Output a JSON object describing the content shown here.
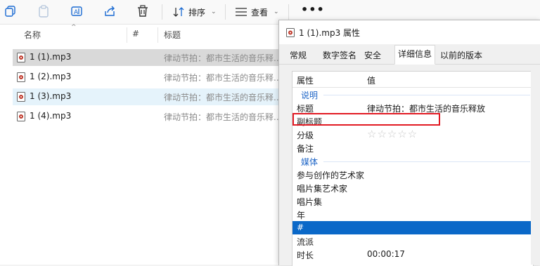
{
  "toolbar": {
    "sort_label": "排序",
    "view_label": "查看",
    "more_label": "•••"
  },
  "list": {
    "columns": {
      "name": "名称",
      "number": "#",
      "title": "标题"
    },
    "files": [
      {
        "name": "1 (1).mp3",
        "title": "律动节拍：都市生活的音乐释..."
      },
      {
        "name": "1 (2).mp3",
        "title": "律动节拍：都市生活的音乐释..."
      },
      {
        "name": "1 (3).mp3",
        "title": "律动节拍：都市生活的音乐释..."
      },
      {
        "name": "1 (4).mp3",
        "title": "律动节拍：都市生活的音乐释..."
      }
    ]
  },
  "dialog": {
    "title": "1 (1).mp3 属性",
    "tabs": [
      "常规",
      "数字签名",
      "安全",
      "详细信息",
      "以前的版本"
    ],
    "active_tab": "详细信息",
    "header": {
      "property": "属性",
      "value": "值"
    },
    "rows": [
      {
        "name": "说明",
        "value": "",
        "group": true
      },
      {
        "name": "标题",
        "value": "律动节拍：都市生活的音乐释放"
      },
      {
        "name": "副标题",
        "value": ""
      },
      {
        "name": "分级",
        "value": "",
        "rating": "☆☆☆☆☆"
      },
      {
        "name": "备注",
        "value": ""
      },
      {
        "name": "媒体",
        "value": "",
        "group": true
      },
      {
        "name": "参与创作的艺术家",
        "value": ""
      },
      {
        "name": "唱片集艺术家",
        "value": ""
      },
      {
        "name": "唱片集",
        "value": ""
      },
      {
        "name": "年",
        "value": ""
      },
      {
        "name": "#",
        "value": "",
        "selected": true
      },
      {
        "name": "流派",
        "value": ""
      },
      {
        "name": "时长",
        "value": "00:00:17"
      }
    ]
  },
  "colors": {
    "accent": "#0a68c8",
    "highlight_box": "#e21a23",
    "group_text": "#1f66c7"
  }
}
